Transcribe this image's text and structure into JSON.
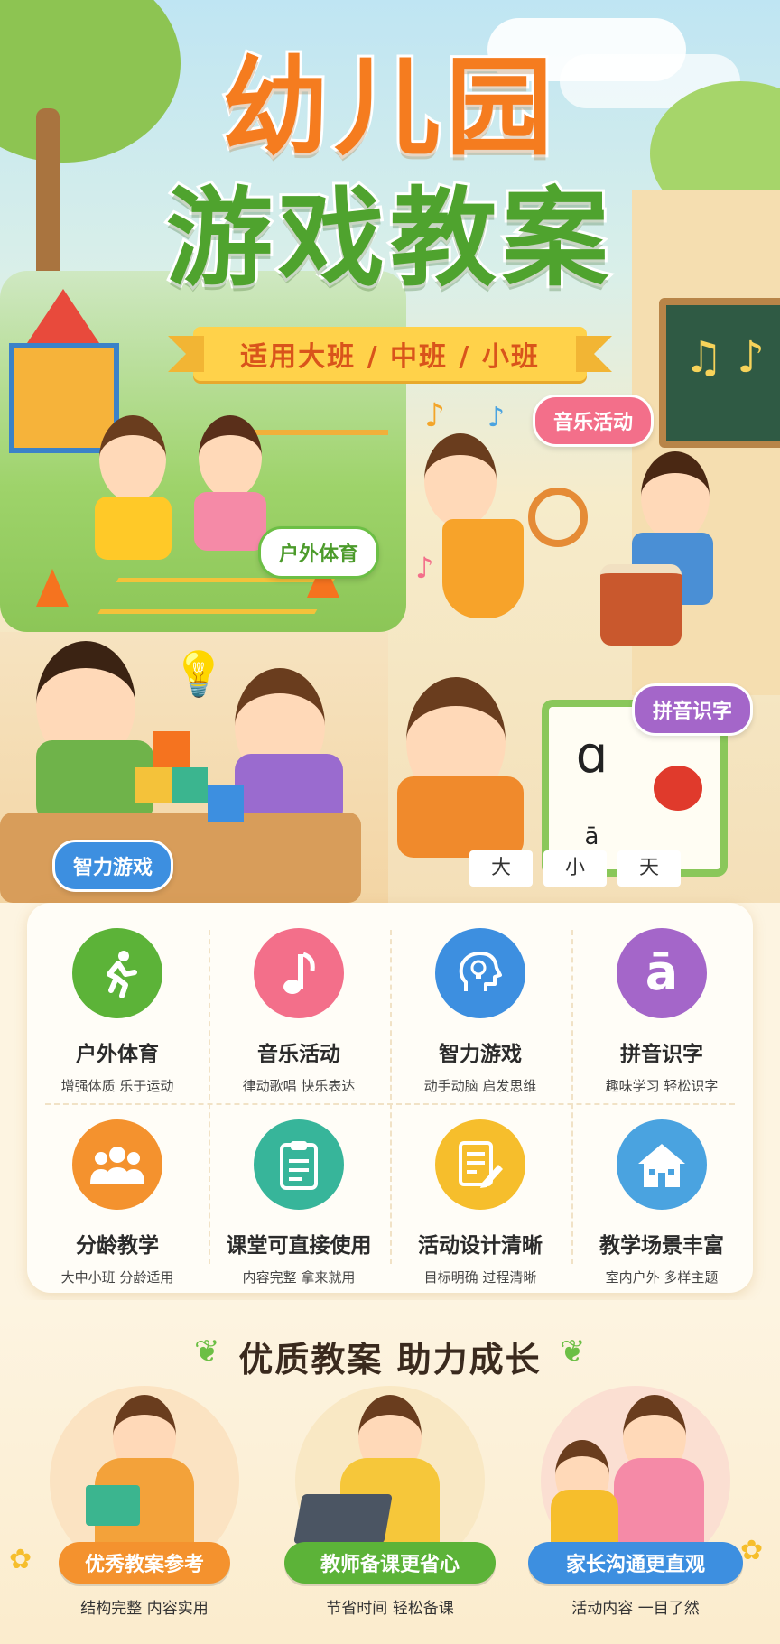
{
  "header": {
    "title_line1": "幼儿园",
    "title_line2": "游戏教案",
    "subtitle": "适用大班 / 中班 / 小班"
  },
  "scene_labels": {
    "outdoor": "户外体育",
    "music": "音乐活动",
    "puzzle": "智力游戏",
    "pinyin": "拼音识字"
  },
  "pinyin_board": {
    "letter": "ɑ",
    "tone_letter": "ā",
    "cards": [
      "大",
      "小",
      "天"
    ]
  },
  "features": [
    {
      "title": "户外体育",
      "sub": "增强体质 乐于运动",
      "icon": "running-person-icon",
      "color": "#5cb338"
    },
    {
      "title": "音乐活动",
      "sub": "律动歌唱 快乐表达",
      "icon": "music-note-icon",
      "color": "#f36f8a"
    },
    {
      "title": "智力游戏",
      "sub": "动手动脑 启发思维",
      "icon": "brain-bulb-icon",
      "color": "#3d8fe0"
    },
    {
      "title": "拼音识字",
      "sub": "趣味学习 轻松识字",
      "icon": "pinyin-a-icon",
      "color": "#a466c9"
    },
    {
      "title": "分龄教学",
      "sub": "大中小班 分龄适用",
      "icon": "group-people-icon",
      "color": "#f4922e"
    },
    {
      "title": "课堂可直接使用",
      "sub": "内容完整 拿来就用",
      "icon": "clipboard-icon",
      "color": "#37b59a"
    },
    {
      "title": "活动设计清晰",
      "sub": "目标明确 过程清晰",
      "icon": "edit-document-icon",
      "color": "#f6be2c"
    },
    {
      "title": "教学场景丰富",
      "sub": "室内户外 多样主题",
      "icon": "school-house-icon",
      "color": "#4aa3e0"
    }
  ],
  "section": {
    "title": "优质教案  助力成长"
  },
  "benefits": [
    {
      "label": "优秀教案参考",
      "sub": "结构完整 内容实用",
      "color": "#f4922e"
    },
    {
      "label": "教师备课更省心",
      "sub": "节省时间 轻松备课",
      "color": "#5cb338"
    },
    {
      "label": "家长沟通更直观",
      "sub": "活动内容 一目了然",
      "color": "#3d8fe0"
    }
  ]
}
